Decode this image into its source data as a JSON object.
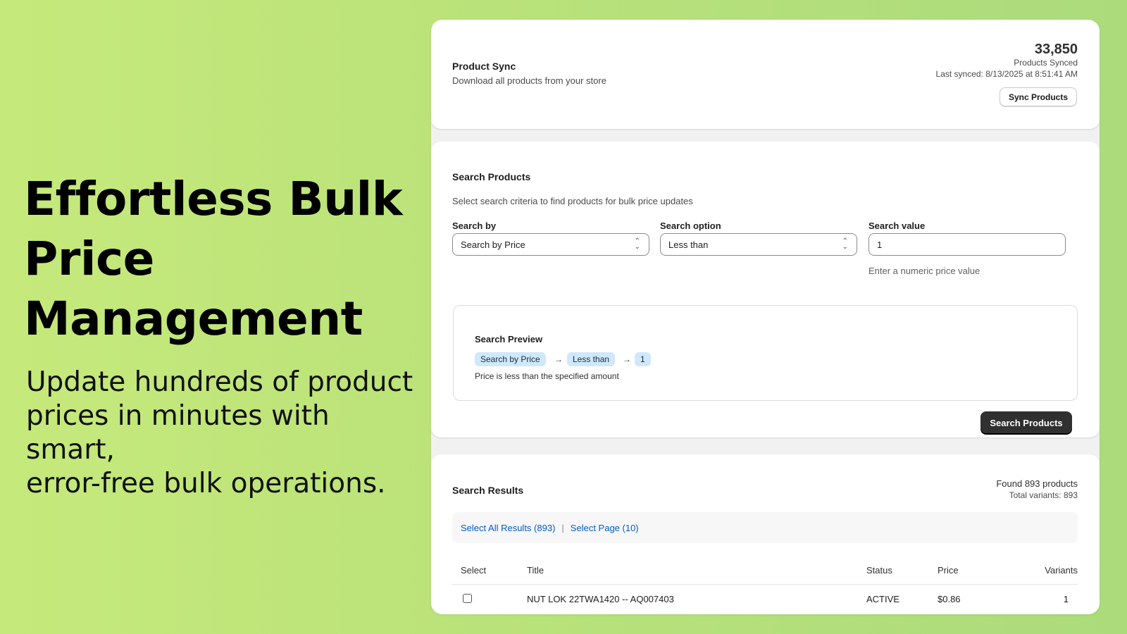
{
  "hero": {
    "title_lines": [
      "Effortless Bulk",
      "Price",
      "Management"
    ],
    "subtitle_lines": [
      "Update hundreds of product",
      "prices in minutes with smart,",
      "error-free bulk operations."
    ]
  },
  "sync": {
    "title": "Product Sync",
    "description": "Download all products from your store",
    "count": "33,850",
    "count_label": "Products Synced",
    "last_synced": "Last synced: 8/13/2025 at 8:51:41 AM",
    "button": "Sync Products"
  },
  "search": {
    "title": "Search Products",
    "description": "Select search criteria to find products for bulk price updates",
    "search_by_label": "Search by",
    "search_by_value": "Search by Price",
    "option_label": "Search option",
    "option_value": "Less than",
    "value_label": "Search value",
    "value_value": "1",
    "value_help": "Enter a numeric price value",
    "preview": {
      "title": "Search Preview",
      "tags": [
        "Search by Price",
        "Less than",
        "1"
      ],
      "arrow": "→",
      "description": "Price is less than the specified amount"
    },
    "button": "Search Products"
  },
  "results": {
    "title": "Search Results",
    "found": "Found 893 products",
    "variants_total": "Total variants: 893",
    "select_all": "Select All Results (893)",
    "separator": "|",
    "select_page": "Select Page (10)",
    "columns": [
      "Select",
      "Title",
      "Status",
      "Price",
      "Variants"
    ],
    "rows": [
      {
        "title": "NUT LOK 22TWA1420 -- AQ007403",
        "status": "ACTIVE",
        "price": "$0.86",
        "variants": "1",
        "checked": false
      }
    ]
  },
  "icons": [
    "chevron-updown-icon",
    "arrow-right-icon",
    "checkbox-icon"
  ],
  "colors": {
    "background": "#c6e97b",
    "accent_link": "#005bd3",
    "primary_button": "#303030",
    "tag_bg": "#cfe8fb"
  }
}
